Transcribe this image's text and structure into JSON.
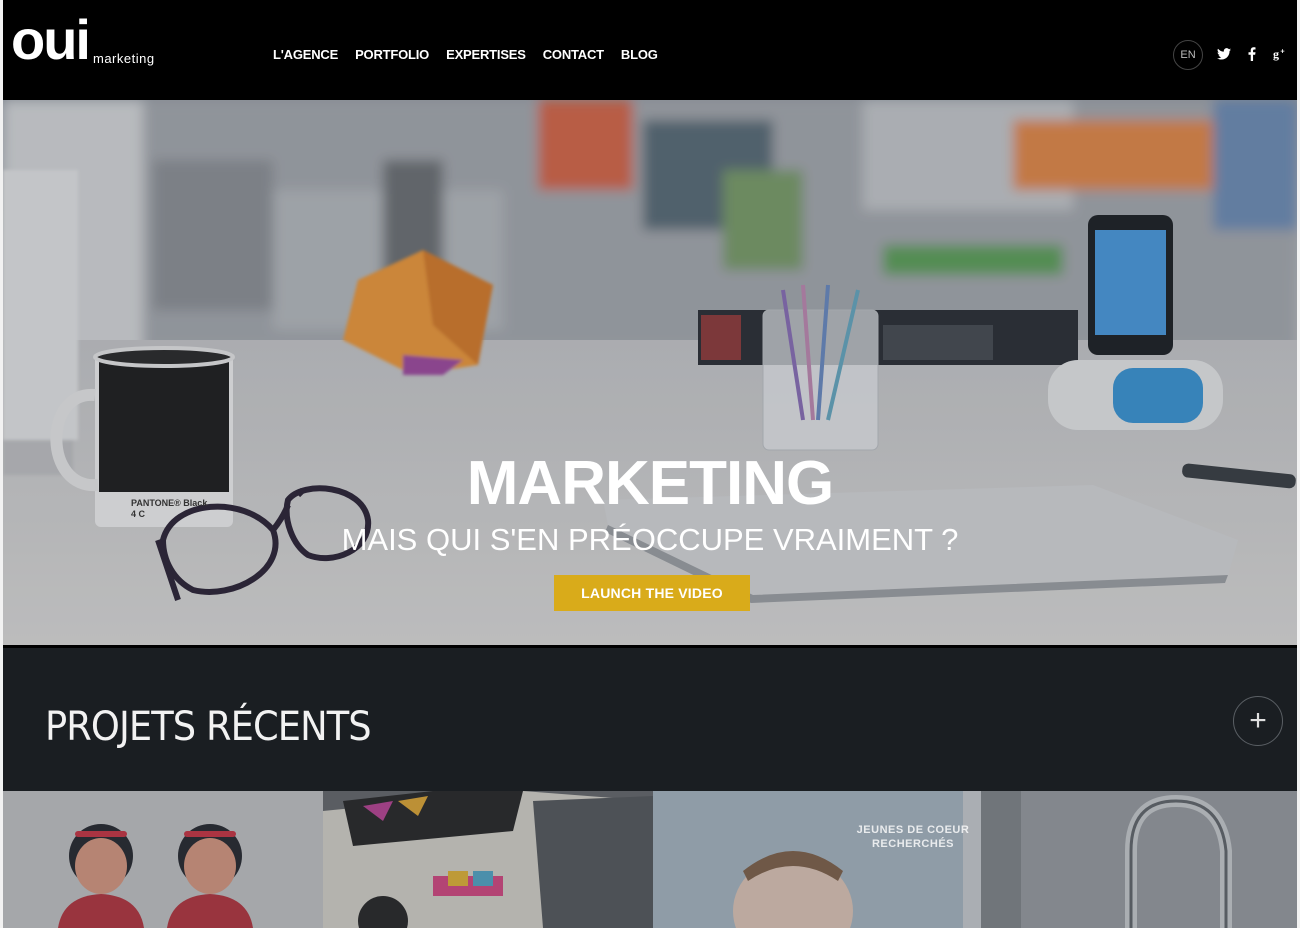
{
  "brand": {
    "name": "oui",
    "tagline": "marketing"
  },
  "nav": {
    "items": [
      "L'AGENCE",
      "PORTFOLIO",
      "EXPERTISES",
      "CONTACT",
      "BLOG"
    ]
  },
  "header_right": {
    "lang": "EN",
    "social": [
      "twitter-icon",
      "facebook-icon",
      "google-plus-icon"
    ],
    "social_glyphs": [
      "ᴛ",
      "f",
      "g+"
    ]
  },
  "hero": {
    "title": "MARKETING",
    "subtitle": "MAIS QUI S'EN PRÉOCCUPE VRAIMENT ?",
    "button": "LAUNCH THE VIDEO",
    "mug_label": "PANTONE® Black 4 C"
  },
  "projects": {
    "title": "PROJETS RÉCENTS",
    "plus": "+"
  },
  "thumbnails": {
    "t3_caption": "JEUNES DE COEUR RECHERCHÉS"
  },
  "colors": {
    "accent": "#d9ab1a",
    "header_bg": "#000000",
    "band_bg": "#1a1e22"
  }
}
